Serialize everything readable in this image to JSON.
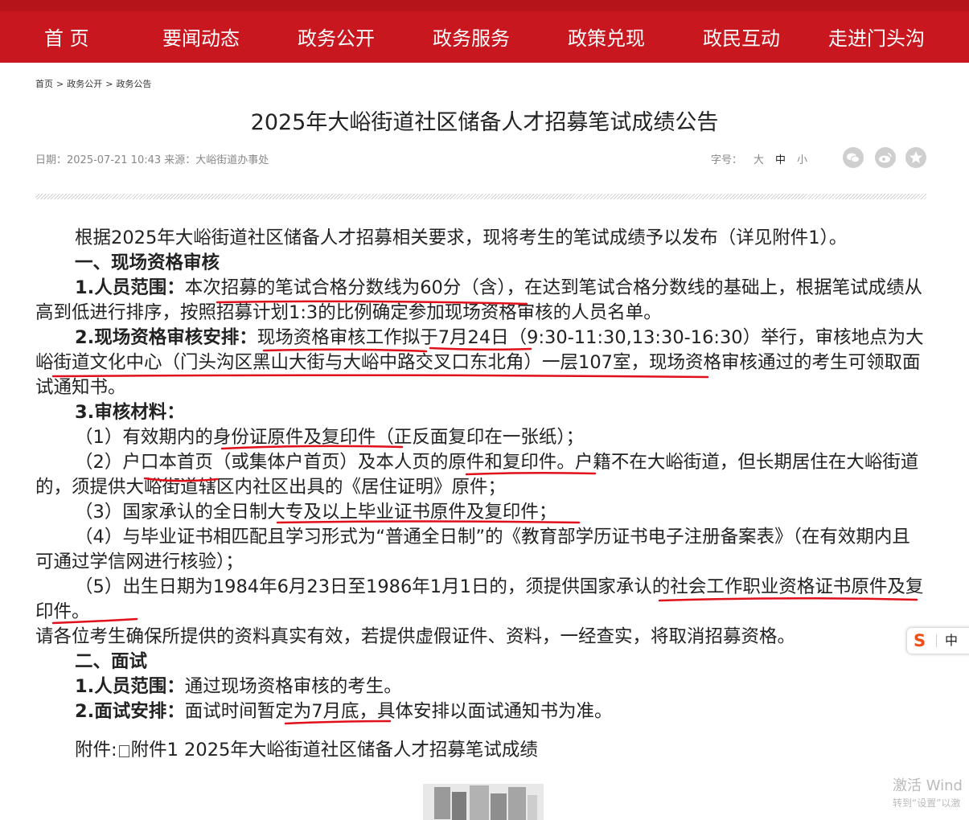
{
  "nav": {
    "items": [
      "首 页",
      "要闻动态",
      "政务公开",
      "政务服务",
      "政策兑现",
      "政民互动",
      "走进门头沟"
    ]
  },
  "breadcrumb": [
    "首页",
    "政务公开",
    "政务公告"
  ],
  "breadcrumb_sep": ">",
  "article": {
    "title": "2025年大峪街道社区储备人才招募笔试成绩公告",
    "meta": "日期：2025-07-21 10:43 来源：大峪街道办事处",
    "fontsize_label": "字号：",
    "fontsize_options": [
      "大",
      "中",
      "小"
    ],
    "share_icons": [
      "wechat-icon",
      "weibo-icon",
      "favorite-icon"
    ],
    "intro": "根据2025年大峪街道社区储备人才招募相关要求，现将考生的笔试成绩予以发布（详见附件1）。",
    "s1_heading": "一、现场资格审核",
    "s1_p1_label": "1.人员范围：",
    "s1_p1_text": "本次招募的笔试合格分数线为60分（含），在达到笔试合格分数线的基础上，根据笔试成绩从高到低进行排序，按照招募计划1:3的比例确定参加现场资格审核的人员名单。",
    "s1_p2_label": "2.现场资格审核安排：",
    "s1_p2_text": "现场资格审核工作拟于7月24日（9:30-11:30,13:30-16:30）举行，审核地点为大峪街道文化中心（门头沟区黑山大街与大峪中路交叉口东北角）一层107室，现场资格审核通过的考生可领取面试通知书。",
    "s1_p3_label": "3.审核材料：",
    "materials": [
      "（1）有效期内的身份证原件及复印件（正反面复印在一张纸）；",
      "（2）户口本首页（或集体户首页）及本人页的原件和复印件。户籍不在大峪街道，但长期居住在大峪街道的，须提供大峪街道辖区内社区出具的《居住证明》原件；",
      "（3）国家承认的全日制大专及以上毕业证书原件及复印件；",
      "（4）与毕业证书相匹配且学习形式为“普通全日制”的《教育部学历证书电子注册备案表》（在有效期内且可通过学信网进行核验）；",
      "（5）出生日期为1984年6月23日至1986年1月1日的，须提供国家承认的社会工作职业资格证书原件及复印件。"
    ],
    "warning": "请各位考生确保所提供的资料真实有效，若提供虚假证件、资料，一经查实，将取消招募资格。",
    "s2_heading": "二、面试",
    "s2_p1_label": "1.人员范围：",
    "s2_p1_text": "通过现场资格审核的考生。",
    "s2_p2_label": "2.面试安排：",
    "s2_p2_text": "面试时间暂定为7月底，具体安排以面试通知书为准。",
    "attachment_label": "附件:",
    "attachment_link": "附件1 2025年大峪街道社区储备人才招募笔试成绩"
  },
  "ime": {
    "brand": "S",
    "mode": "中"
  },
  "os_watermark": {
    "line1": "激活 Wind",
    "line2": "转到“设置”以激"
  },
  "colors": {
    "nav_bg": "#c8171f",
    "annotation": "#e0101a",
    "ime_brand": "#f04d18"
  }
}
